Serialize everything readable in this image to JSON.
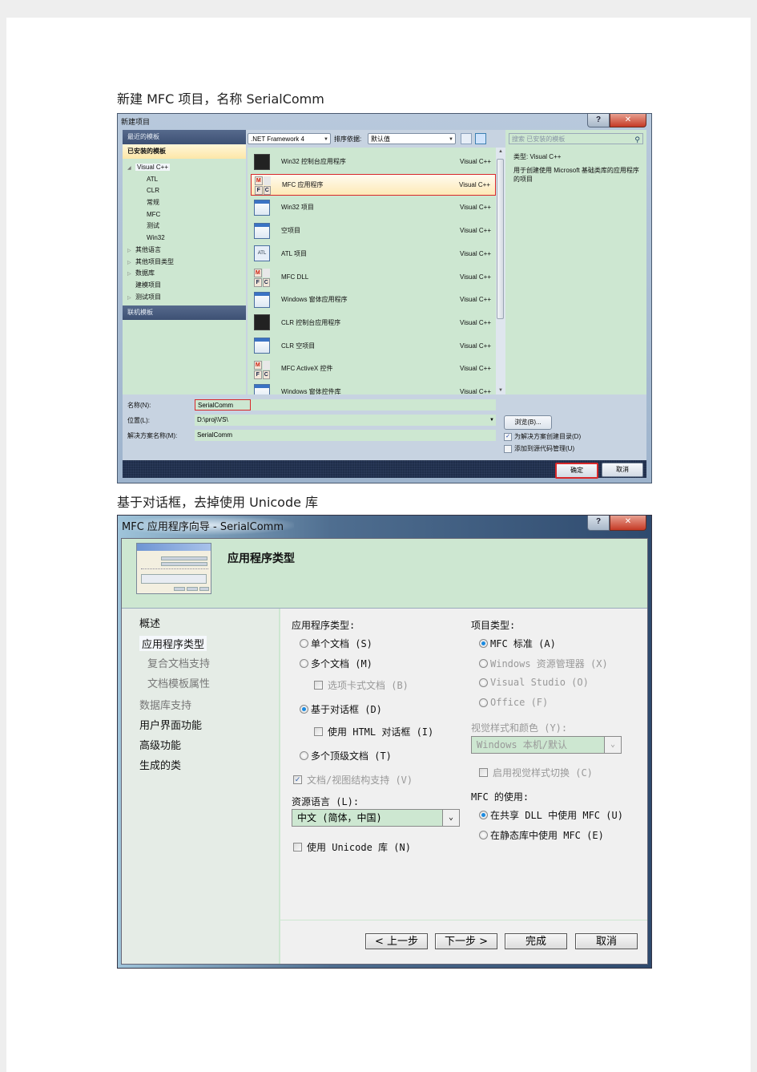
{
  "captions": {
    "first": "新建 MFC 项目，名称 SerialComm",
    "second": "基于对话框，去掉使用 Unicode 库"
  },
  "new_project_dialog": {
    "title": "新建项目",
    "help_icon": "?",
    "close_icon": "✕",
    "left": {
      "recent_templates": "最近的模板",
      "installed_templates": "已安装的模板",
      "tree": [
        {
          "label": "Visual C++",
          "expanded": true,
          "arrow": "◢"
        },
        {
          "label": "ATL",
          "indent": 1
        },
        {
          "label": "CLR",
          "indent": 1
        },
        {
          "label": "常规",
          "indent": 1
        },
        {
          "label": "MFC",
          "indent": 1
        },
        {
          "label": "测试",
          "indent": 1
        },
        {
          "label": "Win32",
          "indent": 1
        },
        {
          "label": "其他语言",
          "arrow": "▷"
        },
        {
          "label": "其他项目类型",
          "arrow": "▷"
        },
        {
          "label": "数据库",
          "arrow": "▷"
        },
        {
          "label": "建模项目"
        },
        {
          "label": "测试项目",
          "arrow": "▷"
        }
      ],
      "online_templates": "联机模板"
    },
    "toolbar": {
      "framework": ".NET Framework 4",
      "sort_label": "排序依据:",
      "sort_value": "默认值"
    },
    "templates": [
      {
        "name": "Win32 控制台应用程序",
        "lang": "Visual C++",
        "icon": "console"
      },
      {
        "name": "MFC 应用程序",
        "lang": "Visual C++",
        "icon": "mfc",
        "selected": true
      },
      {
        "name": "Win32 项目",
        "lang": "Visual C++",
        "icon": "window"
      },
      {
        "name": "空项目",
        "lang": "Visual C++",
        "icon": "window"
      },
      {
        "name": "ATL 项目",
        "lang": "Visual C++",
        "icon": "atl"
      },
      {
        "name": "MFC DLL",
        "lang": "Visual C++",
        "icon": "mfc"
      },
      {
        "name": "Windows 窗体应用程序",
        "lang": "Visual C++",
        "icon": "window"
      },
      {
        "name": "CLR 控制台应用程序",
        "lang": "Visual C++",
        "icon": "console"
      },
      {
        "name": "CLR 空项目",
        "lang": "Visual C++",
        "icon": "window"
      },
      {
        "name": "MFC ActiveX 控件",
        "lang": "Visual C++",
        "icon": "mfc"
      },
      {
        "name": "Windows 窗体控件库",
        "lang": "Visual C++",
        "icon": "window"
      }
    ],
    "search_placeholder": "搜索 已安装的模板",
    "description": {
      "type_line": "类型: Visual C++",
      "text": "用于创建使用 Microsoft 基础类库的应用程序的项目"
    },
    "form": {
      "name_label": "名称(N):",
      "name_value": "SerialComm",
      "location_label": "位置(L):",
      "location_value": "D:\\proj\\VS\\",
      "solution_label": "解决方案名称(M):",
      "solution_value": "SerialComm",
      "browse": "浏览(B)...",
      "create_dir_label": "为解决方案创建目录(D)",
      "create_dir_checked": true,
      "add_scc_label": "添加到源代码管理(U)",
      "add_scc_checked": false
    },
    "ok": "确定",
    "cancel": "取消"
  },
  "wizard": {
    "title": "MFC 应用程序向导 - SerialComm",
    "help_icon": "?",
    "close_icon": "✕",
    "heading": "应用程序类型",
    "nav": [
      {
        "label": "概述"
      },
      {
        "label": "应用程序类型",
        "selected": true
      },
      {
        "label": "复合文档支持",
        "sub": true
      },
      {
        "label": "文档模板属性",
        "sub": true
      },
      {
        "label": "数据库支持",
        "disabled": true
      },
      {
        "label": "用户界面功能"
      },
      {
        "label": "高级功能"
      },
      {
        "label": "生成的类"
      }
    ],
    "app_type": {
      "label": "应用程序类型:",
      "single_doc": "单个文档 (S)",
      "multi_doc": "多个文档 (M)",
      "tabbed_docs": "选项卡式文档 (B)",
      "dialog_based": "基于对话框 (D)",
      "html_dialog": "使用 HTML 对话框 (I)",
      "multi_top": "多个顶级文档 (T)",
      "selected": "dialog_based",
      "doc_view": "文档/视图结构支持 (V)",
      "doc_view_checked": true
    },
    "resource_lang": {
      "label": "资源语言 (L):",
      "value": "中文 (简体，中国)"
    },
    "use_unicode": {
      "label": "使用 Unicode 库 (N)",
      "checked": false
    },
    "project_type": {
      "label": "项目类型:",
      "mfc_standard": "MFC 标准 (A)",
      "explorer": "Windows 资源管理器 (X)",
      "vs": "Visual Studio (O)",
      "office": "Office (F)",
      "selected": "mfc_standard"
    },
    "visual_style": {
      "label": "视觉样式和颜色 (Y):",
      "value": "Windows 本机/默认",
      "toggle_label": "启用视觉样式切换 (C)"
    },
    "mfc_use": {
      "label": "MFC 的使用:",
      "shared": "在共享 DLL 中使用 MFC (U)",
      "static": "在静态库中使用 MFC (E)",
      "selected": "shared"
    },
    "buttons": {
      "prev": "< 上一步",
      "next": "下一步 >",
      "finish": "完成",
      "cancel": "取消"
    }
  }
}
